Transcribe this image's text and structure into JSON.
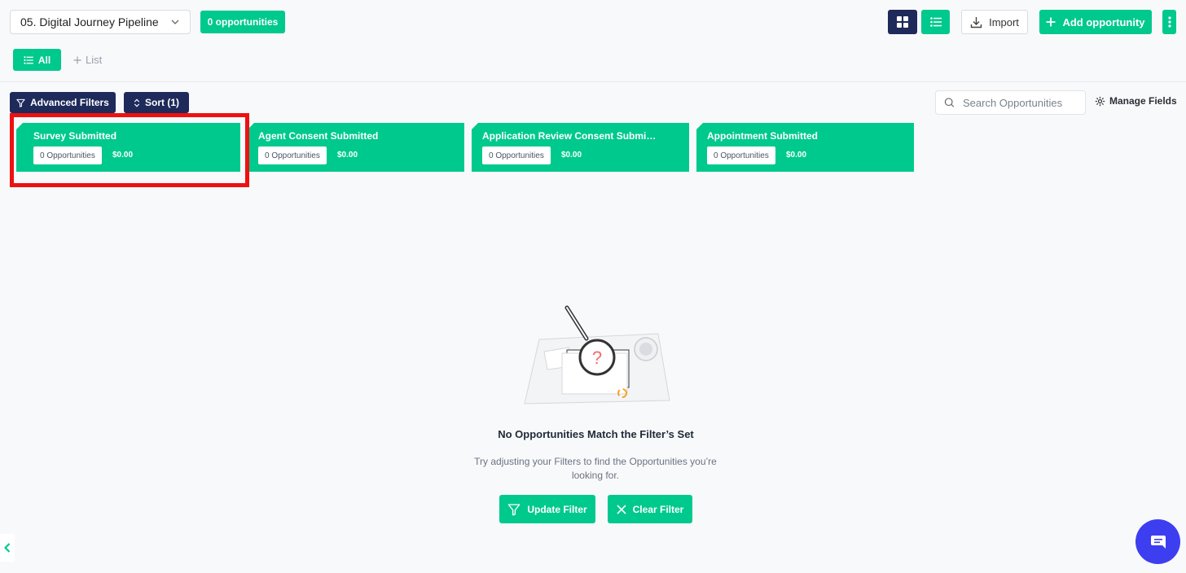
{
  "header": {
    "pipeline_select": "05. Digital Journey Pipeline",
    "opportunity_count": "0 opportunities",
    "import_label": "Import",
    "add_label": "Add opportunity"
  },
  "tabs": {
    "all_label": "All",
    "add_list_label": "List"
  },
  "toolbar": {
    "advanced_filters_label": "Advanced Filters",
    "sort_label": "Sort (1)",
    "search_placeholder": "Search Opportunities",
    "manage_fields_label": "Manage Fields"
  },
  "stages": [
    {
      "title": "Survey Submitted",
      "count": "0 Opportunities",
      "amount": "$0.00"
    },
    {
      "title": "Agent Consent Submitted",
      "count": "0 Opportunities",
      "amount": "$0.00"
    },
    {
      "title": "Application Review Consent Submi…",
      "count": "0 Opportunities",
      "amount": "$0.00"
    },
    {
      "title": "Appointment Submitted",
      "count": "0 Opportunities",
      "amount": "$0.00"
    }
  ],
  "empty_state": {
    "title": "No Opportunities Match the Filter’s Set",
    "description": "Try adjusting your Filters to find the Opportunities you’re looking for.",
    "update_label": "Update Filter",
    "clear_label": "Clear Filter"
  },
  "colors": {
    "accent_green": "#00c98d",
    "navy": "#1e2a5a",
    "highlight_red": "#ee1111",
    "chat_blue": "#3d3ef0"
  }
}
